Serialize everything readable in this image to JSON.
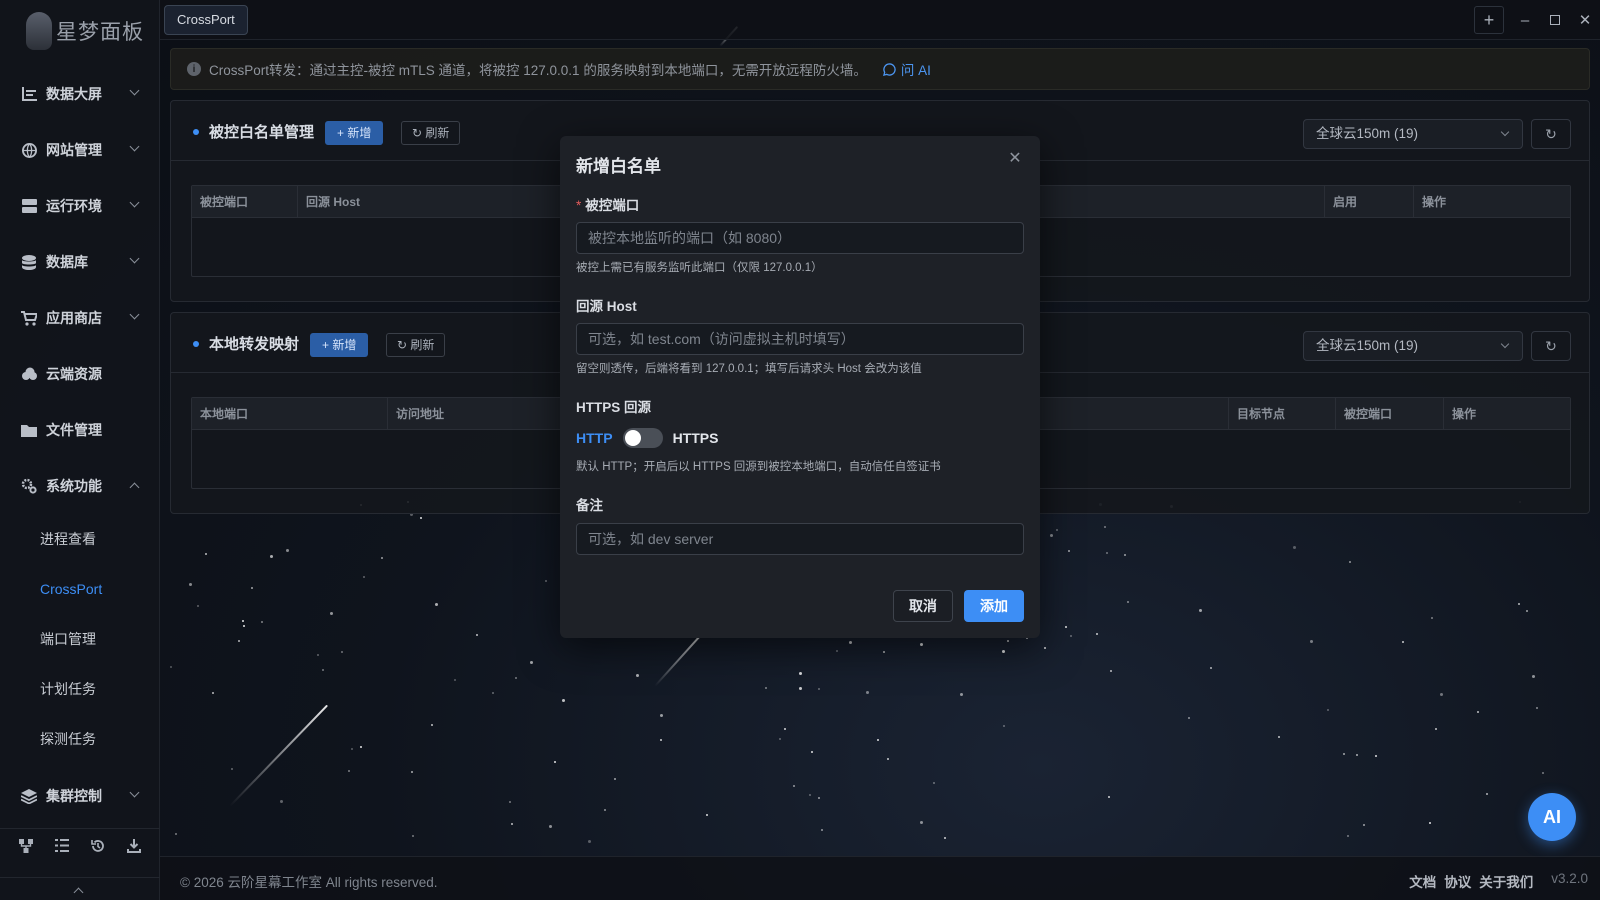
{
  "app": {
    "logo_text": "星梦面板",
    "active_tab": "CrossPort"
  },
  "sidebar": {
    "items": [
      {
        "label": "数据大屏",
        "icon": "chart-icon"
      },
      {
        "label": "网站管理",
        "icon": "globe-icon"
      },
      {
        "label": "运行环境",
        "icon": "server-icon"
      },
      {
        "label": "数据库",
        "icon": "database-icon"
      },
      {
        "label": "应用商店",
        "icon": "cart-icon"
      },
      {
        "label": "云端资源",
        "icon": "cloud-icon"
      },
      {
        "label": "文件管理",
        "icon": "folder-icon"
      },
      {
        "label": "系统功能",
        "icon": "gears-icon"
      }
    ],
    "sub_items": [
      "进程查看",
      "CrossPort",
      "端口管理",
      "计划任务",
      "探测任务"
    ],
    "cluster": {
      "label": "集群控制",
      "icon": "layers-icon"
    }
  },
  "info": {
    "text": "CrossPort转发：通过主控-被控 mTLS 通道，将被控 127.0.0.1 的服务映射到本地端口，无需开放远程防火墙。",
    "ask_ai": "问 AI"
  },
  "whitelist_panel": {
    "title": "被控白名单管理",
    "add": "+ 新增",
    "refresh": "刷新",
    "node_select": "全球云150m (19)",
    "columns": [
      "被控端口",
      "回源 Host",
      "启用",
      "操作"
    ]
  },
  "forward_panel": {
    "title": "本地转发映射",
    "add": "+ 新增",
    "refresh": "刷新",
    "node_select": "全球云150m (19)",
    "columns": [
      "本地端口",
      "访问地址",
      "目标节点",
      "被控端口",
      "操作"
    ]
  },
  "modal": {
    "title": "新增白名单",
    "port_label": "被控端口",
    "port_placeholder": "被控本地监听的端口（如 8080）",
    "port_help": "被控上需已有服务监听此端口（仅限 127.0.0.1）",
    "host_label": "回源 Host",
    "host_placeholder": "可选，如 test.com（访问虚拟主机时填写）",
    "host_help": "留空则透传，后端将看到 127.0.0.1；填写后请求头 Host 会改为该值",
    "https_label": "HTTPS 回源",
    "http_text": "HTTP",
    "https_text": "HTTPS",
    "https_help": "默认 HTTP；开启后以 HTTPS 回源到被控本地端口，自动信任自签证书",
    "note_label": "备注",
    "note_placeholder": "可选，如 dev server",
    "cancel": "取消",
    "submit": "添加"
  },
  "footer": {
    "copyright": "© 2026 云阶星幕工作室 All rights reserved.",
    "links": [
      "文档",
      "协议",
      "关于我们"
    ],
    "version": "v3.2.0"
  },
  "ai_button": "AI",
  "colors": {
    "accent": "#3d8ef5",
    "required": "#e35b5b"
  }
}
